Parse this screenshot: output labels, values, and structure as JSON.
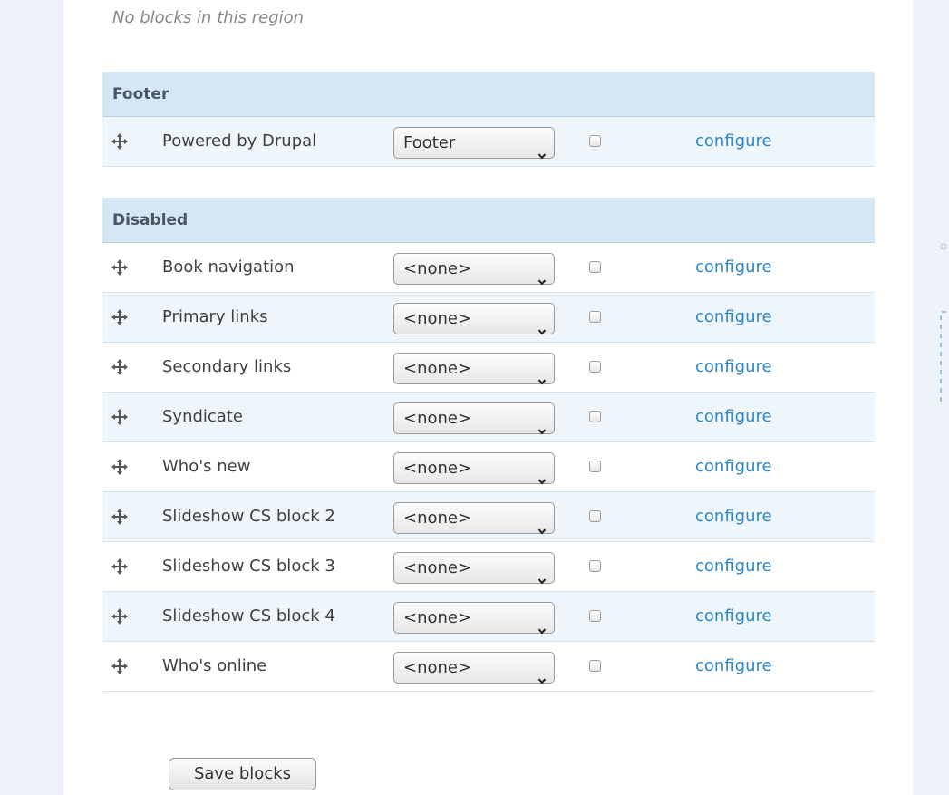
{
  "empty_region_note": "No blocks in this region",
  "regions": [
    {
      "name": "Footer",
      "blocks": [
        {
          "title": "Powered by Drupal",
          "region": "Footer",
          "configure": "configure"
        }
      ]
    },
    {
      "name": "Disabled",
      "blocks": [
        {
          "title": "Book navigation",
          "region": "<none>",
          "configure": "configure"
        },
        {
          "title": "Primary links",
          "region": "<none>",
          "configure": "configure"
        },
        {
          "title": "Secondary links",
          "region": "<none>",
          "configure": "configure"
        },
        {
          "title": "Syndicate",
          "region": "<none>",
          "configure": "configure"
        },
        {
          "title": "Who's new",
          "region": "<none>",
          "configure": "configure"
        },
        {
          "title": "Slideshow CS block 2",
          "region": "<none>",
          "configure": "configure"
        },
        {
          "title": "Slideshow CS block 3",
          "region": "<none>",
          "configure": "configure"
        },
        {
          "title": "Slideshow CS block 4",
          "region": "<none>",
          "configure": "configure"
        },
        {
          "title": "Who's online",
          "region": "<none>",
          "configure": "configure"
        }
      ]
    }
  ],
  "save_button": "Save blocks",
  "icons": {
    "drag": "drag-handle-icon",
    "select": "chevron-down-icon"
  },
  "colors": {
    "link": "#2e87c6",
    "header_bg": "#d5e6f4",
    "alt_row_bg": "#eef5fb"
  }
}
